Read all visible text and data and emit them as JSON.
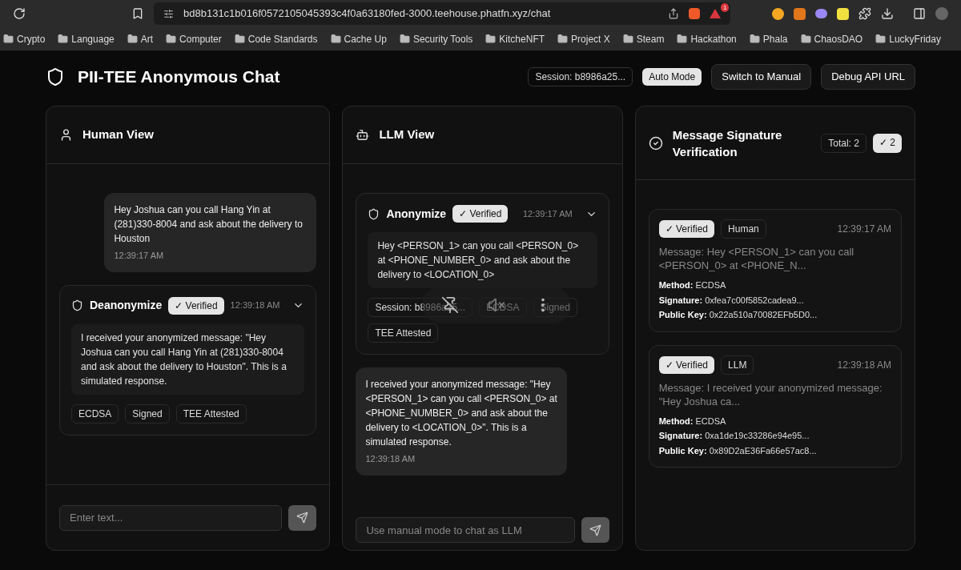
{
  "browser": {
    "url": "bd8b131c1b016f0572105045393c4f0a63180fed-3000.teehouse.phatfn.xyz/chat",
    "notification_count": "1",
    "bookmarks": [
      "Crypto",
      "Language",
      "Art",
      "Computer",
      "Code Standards",
      "Cache Up",
      "Security Tools",
      "KitcheNFT",
      "Project X",
      "Steam",
      "Hackathon",
      "Phala",
      "ChaosDAO",
      "LuckyFriday"
    ]
  },
  "header": {
    "title": "PII-TEE Anonymous Chat",
    "session": "Session: b8986a25...",
    "mode": "Auto Mode",
    "buttons": [
      "Switch to Manual",
      "Debug API URL"
    ]
  },
  "human_view": {
    "title": "Human View",
    "messages": [
      {
        "kind": "bubble",
        "text": "Hey Joshua can you call Hang Yin at (281)330-8004 and ask about the delivery to Houston",
        "time": "12:39:17 AM"
      },
      {
        "kind": "card",
        "title": "Deanonymize",
        "status": "✓ Verified",
        "time": "12:39:18 AM",
        "text": "I received your anonymized message: \"Hey Joshua can you call Hang Yin at (281)330-8004 and ask about the delivery to Houston\". This is a simulated response.",
        "tags": [
          "ECDSA",
          "Signed",
          "TEE Attested"
        ]
      }
    ],
    "input": {
      "placeholder": "Enter text..."
    }
  },
  "llm_view": {
    "title": "LLM View",
    "messages": [
      {
        "kind": "card",
        "title": "Anonymize",
        "status": "✓ Verified",
        "time": "12:39:17 AM",
        "text": "Hey <PERSON_1> can you call <PERSON_0> at <PHONE_NUMBER_0> and ask about the delivery to <LOCATION_0>",
        "tags": [
          "Session: b8986a25...",
          "ECDSA",
          "Signed",
          "TEE Attested"
        ]
      },
      {
        "kind": "bubble",
        "text": "I received your anonymized message: \"Hey <PERSON_1> can you call <PERSON_0> at <PHONE_NUMBER_0> and ask about the delivery to <LOCATION_0>\". This is a simulated response.",
        "time": "12:39:18 AM"
      }
    ],
    "input": {
      "placeholder": "Use manual mode to chat as LLM"
    }
  },
  "verification": {
    "title": "Message Signature Verification",
    "total": "Total: 2",
    "verified_count": "✓ 2",
    "items": [
      {
        "status": "✓ Verified",
        "source": "Human",
        "time": "12:39:17 AM",
        "message": "Message: Hey <PERSON_1> can you call <PERSON_0> at <PHONE_N...",
        "fields": [
          {
            "label": "Method:",
            "value": "ECDSA"
          },
          {
            "label": "Signature:",
            "value": "0xfea7c00f5852cadea9..."
          },
          {
            "label": "Public Key:",
            "value": "0x22a510a70082EFb5D0..."
          }
        ]
      },
      {
        "status": "✓ Verified",
        "source": "LLM",
        "time": "12:39:18 AM",
        "message": "Message: I received your anonymized message: \"Hey Joshua ca...",
        "fields": [
          {
            "label": "Method:",
            "value": "ECDSA"
          },
          {
            "label": "Signature:",
            "value": "0xa1de19c33286e94e95..."
          },
          {
            "label": "Public Key:",
            "value": "0x89D2aE36Fa66e57ac8..."
          }
        ]
      }
    ]
  }
}
